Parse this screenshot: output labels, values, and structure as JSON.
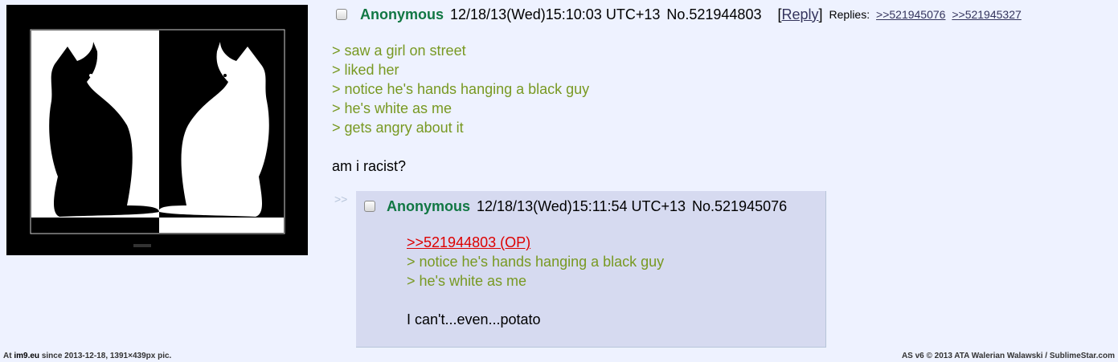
{
  "image": {
    "icon": "two-cats-black-white-image"
  },
  "op": {
    "name": "Anonymous",
    "datetime": "12/18/13(Wed)15:10:03 UTC+13",
    "post_no": "No.521944803",
    "reply_open": "[",
    "reply_label": "Reply",
    "reply_close": "]",
    "replies_label": "Replies:",
    "replies": [
      ">>521945076",
      ">>521945327"
    ],
    "lines": [
      "> saw a girl on street",
      "> liked her",
      "> notice he's hands hanging a black guy",
      "> he's white as me",
      "> gets angry about it"
    ],
    "text": "am i racist?"
  },
  "reply": {
    "arrows": ">>",
    "name": "Anonymous",
    "datetime": "12/18/13(Wed)15:11:54 UTC+13",
    "post_no": "No.521945076",
    "backlink": ">>521944803 (OP)",
    "lines": [
      "> notice he's hands hanging a black guy",
      "> he's white as me"
    ],
    "text": "I can't...even...potato"
  },
  "footer": {
    "left_prefix": "At",
    "left_site": "im9.eu",
    "left_rest": "since 2013-12-18, 1391×439px pic.",
    "right": "AS v6 © 2013 ATA Walerian Walawski / SublimeStar.com"
  }
}
